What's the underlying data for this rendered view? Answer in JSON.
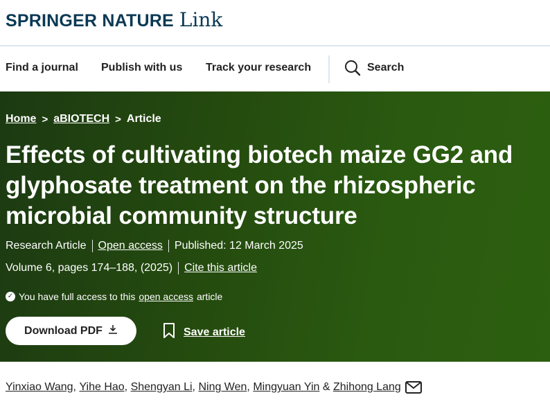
{
  "header": {
    "brand": "SPRINGER NATURE",
    "brand_suffix": "Link"
  },
  "nav": {
    "items": [
      {
        "label": "Find a journal"
      },
      {
        "label": "Publish with us"
      },
      {
        "label": "Track your research"
      }
    ],
    "search_label": "Search",
    "search_icon": "search-icon"
  },
  "breadcrumb": {
    "items": [
      "Home",
      "aBIOTECH",
      "Article"
    ],
    "separator": ">"
  },
  "article": {
    "title": "Effects of cultivating biotech maize GG2 and glyphosate treatment on the rhizospheric microbial community structure",
    "type": "Research Article",
    "access_label": "Open access",
    "published": "Published: 12 March 2025",
    "volume": "Volume 6, pages 174–188, (2025)",
    "cite_label": "Cite this article",
    "access_notice": {
      "prefix": "You have full access to this",
      "link": "open access",
      "suffix": "article"
    }
  },
  "actions": {
    "download_label": "Download PDF",
    "save_label": "Save article"
  },
  "authors": {
    "names": [
      "Yinxiao Wang",
      "Yihe Hao",
      "Shengyan Li",
      "Ning Wen",
      "Mingyuan Yin",
      "Zhihong Lang"
    ],
    "separator": ",",
    "last_separator": "&"
  },
  "colors": {
    "brand_text": "#0b3954",
    "hero_bg": "#24490f",
    "divider": "#dbe7ef"
  }
}
